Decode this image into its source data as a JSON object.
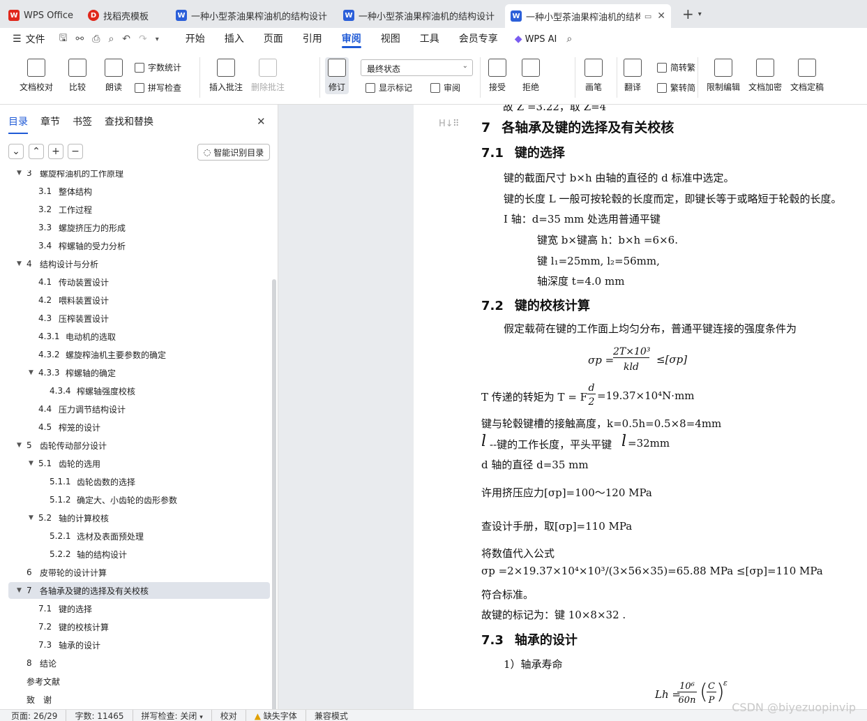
{
  "tabs": [
    {
      "label": "WPS Office",
      "icon": "wps-logo-icon",
      "color": "#e0271b"
    },
    {
      "label": "找稻壳模板",
      "icon": "docer-logo-icon",
      "color": "#e0271b"
    },
    {
      "label": "一种小型茶油果榨油机的结构设计 任",
      "icon": "writer-doc-icon",
      "color": "#2b5fd9"
    },
    {
      "label": "一种小型茶油果榨油机的结构设计 开",
      "icon": "writer-doc-icon",
      "color": "#2b5fd9"
    },
    {
      "label": "一种小型茶油果榨油机的结构",
      "icon": "writer-doc-icon",
      "color": "#2b5fd9"
    }
  ],
  "menu": {
    "file": "文件",
    "items": [
      "开始",
      "插入",
      "页面",
      "引用",
      "审阅",
      "视图",
      "工具",
      "会员专享"
    ],
    "active": "审阅",
    "wps_ai": "WPS AI"
  },
  "ribbon": {
    "doc_proof": "文档校对",
    "compare": "比较",
    "read_aloud": "朗读",
    "word_count": "字数统计",
    "spell_check": "拼写检查",
    "insert_comment": "插入批注",
    "delete_comment": "删除批注",
    "track_changes": "修订",
    "final_state": "最终状态",
    "show_markup": "显示标记",
    "review_pane": "审阅",
    "accept": "接受",
    "reject": "拒绝",
    "pen": "画笔",
    "translate": "翻译",
    "to_traditional": "简转繁",
    "to_simplified": "繁转简",
    "restrict_edit": "限制编辑",
    "encrypt": "文档加密",
    "finalize": "文档定稿"
  },
  "nav": {
    "tabs": [
      "目录",
      "章节",
      "书签",
      "查找和替换"
    ],
    "active_tab": "目录",
    "smart_toc": "智能识别目录",
    "toc": [
      {
        "num": "3",
        "text": "螺旋榨油机的工作原理",
        "level": 1,
        "arrow": true
      },
      {
        "num": "3.1",
        "text": "整体结构",
        "level": 2
      },
      {
        "num": "3.2",
        "text": "工作过程",
        "level": 2
      },
      {
        "num": "3.3",
        "text": "螺旋挤压力的形成",
        "level": 2
      },
      {
        "num": "3.4",
        "text": "榨螺轴的受力分析",
        "level": 2
      },
      {
        "num": "4",
        "text": "结构设计与分析",
        "level": 1,
        "arrow": true
      },
      {
        "num": "4.1",
        "text": "传动装置设计",
        "level": 2
      },
      {
        "num": "4.2",
        "text": "喂料装置设计",
        "level": 2
      },
      {
        "num": "4.3",
        "text": "压榨装置设计",
        "level": 2
      },
      {
        "num": "4.3.1",
        "text": "电动机的选取",
        "level": 2
      },
      {
        "num": "4.3.2",
        "text": "螺旋榨油机主要参数的确定",
        "level": 2
      },
      {
        "num": "4.3.3",
        "text": "榨螺轴的确定",
        "level": 2,
        "arrow": true
      },
      {
        "num": "4.3.4",
        "text": "榨螺轴强度校核",
        "level": 3
      },
      {
        "num": "4.4",
        "text": "压力调节结构设计",
        "level": 2
      },
      {
        "num": "4.5",
        "text": "榨笼的设计",
        "level": 2
      },
      {
        "num": "5",
        "text": "齿轮传动部分设计",
        "level": 1,
        "arrow": true
      },
      {
        "num": "5.1",
        "text": "齿轮的选用",
        "level": 2,
        "arrow": true
      },
      {
        "num": "5.1.1",
        "text": "齿轮齿数的选择",
        "level": 3
      },
      {
        "num": "5.1.2",
        "text": "确定大、小齿轮的齿形参数",
        "level": 3
      },
      {
        "num": "5.2",
        "text": "轴的计算校核",
        "level": 2,
        "arrow": true
      },
      {
        "num": "5.2.1",
        "text": "选材及表面预处理",
        "level": 3
      },
      {
        "num": "5.2.2",
        "text": "轴的结构设计",
        "level": 3
      },
      {
        "num": "6",
        "text": "皮带轮的设计计算",
        "level": 1
      },
      {
        "num": "7",
        "text": "各轴承及键的选择及有关校核",
        "level": 1,
        "arrow": true,
        "selected": true
      },
      {
        "num": "7.1",
        "text": "键的选择",
        "level": 2
      },
      {
        "num": "7.2",
        "text": "键的校核计算",
        "level": 2
      },
      {
        "num": "7.3",
        "text": "轴承的设计",
        "level": 2
      },
      {
        "num": "8",
        "text": "结论",
        "level": 1
      },
      {
        "num": "",
        "text": "参考文献",
        "level": 1
      },
      {
        "num": "",
        "text": "致　谢",
        "level": 1
      }
    ]
  },
  "doc": {
    "top_partial": "故 Z =3.22，取 Z=4",
    "h_marker": "H↓",
    "h1": {
      "num": "7",
      "text": "各轴承及键的选择及有关校核"
    },
    "s71": {
      "num": "7.1",
      "text": "键的选择"
    },
    "p1": "键的截面尺寸 b×h 由轴的直径的 d 标准中选定。",
    "p2": "键的长度 L 一般可按轮毂的长度而定，即键长等于或略短于轮毂的长度。",
    "p3": "I 轴：d=35 mm  处选用普通平键",
    "p4": "键宽 b×键高 h：b×h =6×6.",
    "p5": "键 l₁=25mm, l₂=56mm,",
    "p6": "轴深度  t=4.0 mm",
    "s72": {
      "num": "7.2",
      "text": "键的校核计算"
    },
    "p7": "假定载荷在键的工作面上均匀分布，普通平键连接的强度条件为",
    "f1_lhs": "σp =",
    "f1_num": "2T×10³",
    "f1_den": "kld",
    "f1_rhs": "≤[σp]",
    "p8a": "T 传递的转矩为 T = F",
    "p8_num": "d",
    "p8_den": "2",
    "p8b": "=19.37×10⁴N·mm",
    "p9": "键与轮毂键槽的接触高度，k=0.5h=0.5×8=4mm",
    "p10a": "l",
    "p10b": "--键的工作长度，平头平键",
    "p10c": "l",
    "p10d": "=32mm",
    "p11": "d 轴的直径 d=35 mm",
    "p12": "许用挤压应力[σp]=100～120 MPa",
    "p13": "查设计手册，取[σp]=110 MPa",
    "p14": "将数值代入公式",
    "p15": "σp =2×19.37×10⁴×10³/(3×56×35)=65.88 MPa ≤[σp]=110 MPa",
    "p16": "符合标准。",
    "p17": "故键的标记为：键 10×8×32 .",
    "s73": {
      "num": "7.3",
      "text": "轴承的设计"
    },
    "p18": "1）轴承寿命",
    "f2_lhs": "Lh =",
    "f2_num": "10⁶",
    "f2_den": "60n",
    "f2_frac_num": "C",
    "f2_frac_den": "P",
    "f2_exp": "ε"
  },
  "status": {
    "page": "页面: 26/29",
    "words": "字数: 11465",
    "spell": "拼写检查: 关闭",
    "proof": "校对",
    "missing_font": "缺失字体",
    "compat": "兼容模式"
  },
  "watermark": "CSDN @biyezuopinvip"
}
